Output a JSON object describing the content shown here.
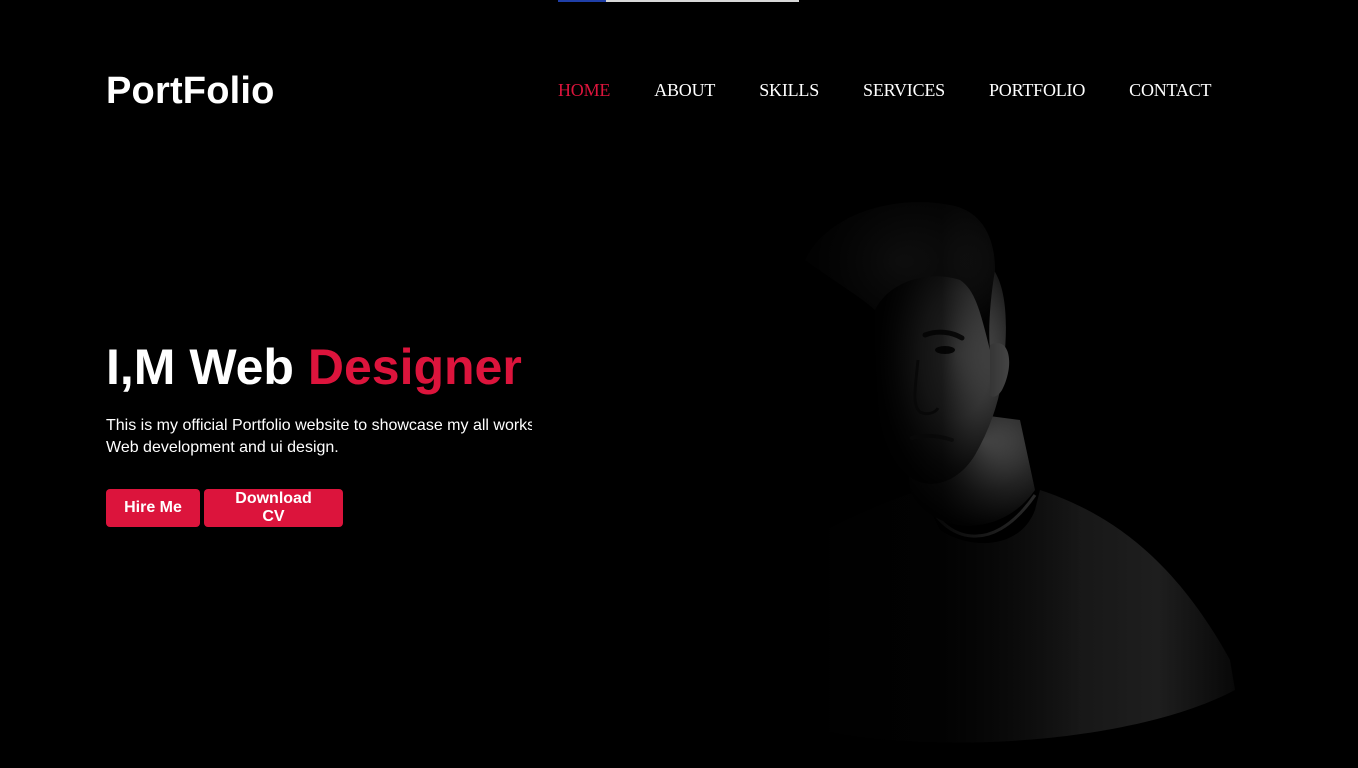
{
  "brand": {
    "logo": "PortFolio"
  },
  "top_bar": {
    "progress": 0.2,
    "fill_color": "#1f3fa8"
  },
  "nav": {
    "items": [
      {
        "label": "HOME",
        "active": true
      },
      {
        "label": "ABOUT",
        "active": false
      },
      {
        "label": "SKILLS",
        "active": false
      },
      {
        "label": "SERVICES",
        "active": false
      },
      {
        "label": "PORTFOLIO",
        "active": false
      },
      {
        "label": "CONTACT",
        "active": false
      }
    ]
  },
  "hero": {
    "title_prefix": "I,M Web ",
    "title_accent": "Designer",
    "description_line1": "This is my official Portfolio website to showcase my all works",
    "description_line2": "Web development and ui design.",
    "hire_button": "Hire Me",
    "cv_button": "Download CV"
  },
  "colors": {
    "background": "#000000",
    "accent": "#dc143c",
    "text": "#ffffff"
  }
}
